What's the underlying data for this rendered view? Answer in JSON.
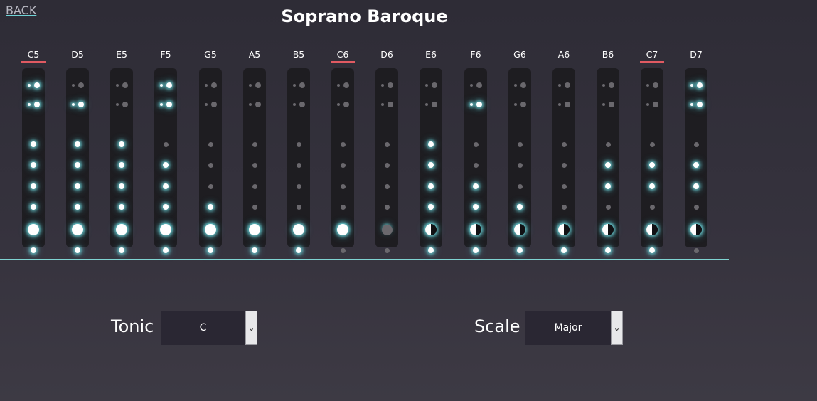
{
  "nav": {
    "back_label": "BACK"
  },
  "title": "Soprano Baroque",
  "notes": [
    {
      "label": "C5",
      "octave_marker": true,
      "thumb": "closed",
      "bell": "closed",
      "holes": [
        "closed",
        "closed",
        "closed",
        "closed",
        "closed",
        "closed",
        "closed"
      ]
    },
    {
      "label": "D5",
      "octave_marker": false,
      "thumb": "open",
      "bell": "closed",
      "holes": [
        "closed",
        "closed",
        "closed",
        "closed",
        "closed",
        "closed",
        "closed"
      ]
    },
    {
      "label": "E5",
      "octave_marker": false,
      "thumb": "open",
      "bell": "closed",
      "holes": [
        "open",
        "closed",
        "closed",
        "closed",
        "closed",
        "closed",
        "closed"
      ]
    },
    {
      "label": "F5",
      "octave_marker": false,
      "thumb": "closed",
      "bell": "closed",
      "holes": [
        "closed",
        "open",
        "closed",
        "closed",
        "closed",
        "closed",
        "closed"
      ]
    },
    {
      "label": "G5",
      "octave_marker": false,
      "thumb": "open",
      "bell": "closed",
      "holes": [
        "open",
        "open",
        "open",
        "open",
        "closed",
        "closed",
        "closed"
      ]
    },
    {
      "label": "A5",
      "octave_marker": false,
      "thumb": "open",
      "bell": "closed",
      "holes": [
        "open",
        "open",
        "open",
        "open",
        "open",
        "closed",
        "closed"
      ]
    },
    {
      "label": "B5",
      "octave_marker": false,
      "thumb": "open",
      "bell": "closed",
      "holes": [
        "open",
        "open",
        "open",
        "open",
        "open",
        "open",
        "closed"
      ]
    },
    {
      "label": "C6",
      "octave_marker": true,
      "thumb": "open",
      "bell": "closed",
      "holes": [
        "open",
        "open",
        "open",
        "open",
        "open",
        "closed",
        "open"
      ]
    },
    {
      "label": "D6",
      "octave_marker": false,
      "thumb": "open",
      "bell": "open",
      "holes": [
        "open",
        "open",
        "open",
        "open",
        "open",
        "closed",
        "open"
      ]
    },
    {
      "label": "E6",
      "octave_marker": false,
      "thumb": "open",
      "bell": "half",
      "holes": [
        "open",
        "closed",
        "closed",
        "closed",
        "closed",
        "closed",
        "closed"
      ]
    },
    {
      "label": "F6",
      "octave_marker": false,
      "thumb": "open",
      "bell": "half",
      "holes": [
        "closed",
        "open",
        "open",
        "closed",
        "closed",
        "closed",
        "closed"
      ]
    },
    {
      "label": "G6",
      "octave_marker": false,
      "thumb": "open",
      "bell": "half",
      "holes": [
        "open",
        "open",
        "open",
        "open",
        "closed",
        "closed",
        "closed"
      ]
    },
    {
      "label": "A6",
      "octave_marker": false,
      "thumb": "open",
      "bell": "half",
      "holes": [
        "open",
        "open",
        "open",
        "open",
        "open",
        "closed",
        "closed"
      ]
    },
    {
      "label": "B6",
      "octave_marker": false,
      "thumb": "open",
      "bell": "half",
      "holes": [
        "open",
        "open",
        "closed",
        "closed",
        "open",
        "closed",
        "closed"
      ]
    },
    {
      "label": "C7",
      "octave_marker": true,
      "thumb": "open",
      "bell": "half",
      "holes": [
        "open",
        "open",
        "closed",
        "closed",
        "open",
        "open",
        "closed"
      ]
    },
    {
      "label": "D7",
      "octave_marker": false,
      "thumb": "closed",
      "bell": "half",
      "holes": [
        "closed",
        "open",
        "closed",
        "closed",
        "open",
        "closed",
        "open"
      ]
    }
  ],
  "controls": {
    "tonic": {
      "label": "Tonic",
      "value": "C"
    },
    "scale": {
      "label": "Scale",
      "value": "Major"
    }
  },
  "colors": {
    "accent": "#7fd4d2",
    "octave_marker": "#e05a62",
    "glow": "#78e6eb"
  },
  "icons": {
    "dropdown": "chevron-down-icon"
  }
}
